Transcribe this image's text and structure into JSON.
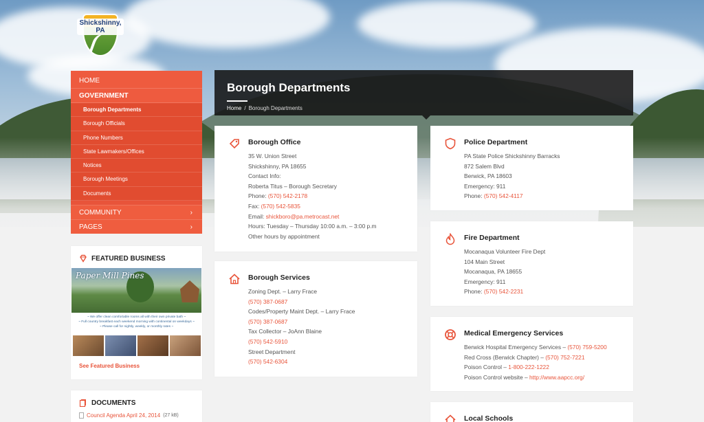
{
  "site": {
    "logo_text": "Shickshinny, PA"
  },
  "colors": {
    "accent": "#e8543a",
    "header_bg": "#141414",
    "page_bg": "#f2f2f2"
  },
  "nav": {
    "home": "HOME",
    "government": "GOVERNMENT",
    "government_items": [
      "Borough Departments",
      "Borough Officials",
      "Phone Numbers",
      "State Lawmakers/Offices",
      "Notices",
      "Borough Meetings",
      "Documents"
    ],
    "community": "COMMUNITY",
    "pages": "PAGES",
    "chevron": "›"
  },
  "featured": {
    "title": "FEATURED BUSINESS",
    "icon": "diamond-icon",
    "image_title": "Paper Mill Pines",
    "image_text_1": "~ We offer clean comfortable rooms all with their own private bath ~",
    "image_text_2": "~ Full country breakfast each weekend morning with continental on weekdays ~",
    "image_text_3": "~ Please call for nightly, weekly, or monthly rates ~",
    "link": "See Featured Business"
  },
  "documents": {
    "title": "DOCUMENTS",
    "icon": "documents-icon",
    "items": [
      {
        "name": "Council Agenda April 24, 2014",
        "size": "(27 kB)"
      }
    ]
  },
  "page": {
    "title": "Borough Departments",
    "breadcrumb_home": "Home",
    "breadcrumb_sep": "/",
    "breadcrumb_current": "Borough Departments"
  },
  "cards": {
    "office": {
      "title": "Borough Office",
      "icon": "tag-icon",
      "lines": [
        "35 W. Union Street",
        "Shickshinny, PA 18655",
        "Contact Info:",
        "Roberta Titus – Borough Secretary"
      ],
      "phone_label": "Phone: ",
      "phone": "(570) 542-2178",
      "fax_label": "Fax: ",
      "fax": "(570) 542-5835",
      "email_label": "Email: ",
      "email": "shickboro@pa.metrocast.net",
      "hours": "Hours: Tuesday – Thursday 10:00 a.m. – 3:00 p.m",
      "other_hours": "Other hours by appointment"
    },
    "services": {
      "title": "Borough Services",
      "icon": "home-icon",
      "zoning": "Zoning Dept. – Larry Frace",
      "zoning_phone": "(570) 387-0687",
      "codes": "Codes/Property Maint Dept. – Larry Frace",
      "codes_phone": "(570) 387-0687",
      "tax": "Tax Collector – JoAnn Blaine",
      "tax_phone": "(570) 542-5910",
      "street": "Street Department",
      "street_phone": "(570) 542-6304"
    },
    "police": {
      "title": "Police Department",
      "icon": "shield-icon",
      "lines": [
        "PA State Police Shickshinny Barracks",
        "872 Salem Blvd",
        "Berwick, PA 18603",
        "Emergency: 911"
      ],
      "phone_label": "Phone: ",
      "phone": "(570) 542-4117"
    },
    "fire": {
      "title": "Fire Department",
      "icon": "flame-icon",
      "lines": [
        "Mocanaqua Volunteer Fire Dept",
        "104 Main Street",
        "Mocanaqua, PA 18655",
        "Emergency: 911"
      ],
      "phone_label": "Phone: ",
      "phone": "(570) 542-2231"
    },
    "medical": {
      "title": "Medical Emergency Services",
      "icon": "lifebuoy-icon",
      "hospital_label": "Berwick Hospital Emergency Services – ",
      "hospital_phone": "(570) 759-5200",
      "redcross_label": "Red Cross (Berwick Chapter) – ",
      "redcross_phone": "(570) 752-7221",
      "poison_label": "Poison Control – ",
      "poison_phone": "1-800-222-1222",
      "poison_web_label": "Poison Control website – ",
      "poison_web": "http://www.aapcc.org/"
    },
    "schools": {
      "title": "Local Schools",
      "icon": "school-icon"
    }
  }
}
